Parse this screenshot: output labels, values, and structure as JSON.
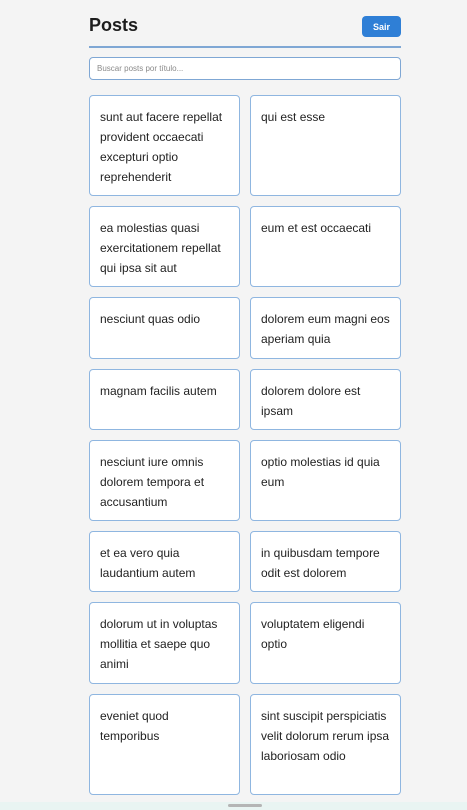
{
  "header": {
    "title": "Posts",
    "logout_label": "Sair"
  },
  "search": {
    "placeholder": "Buscar posts por título...",
    "value": ""
  },
  "posts": [
    {
      "title": "sunt aut facere repellat provident occaecati excepturi optio reprehenderit"
    },
    {
      "title": "qui est esse"
    },
    {
      "title": "ea molestias quasi exercitationem repellat qui ipsa sit aut"
    },
    {
      "title": "eum et est occaecati"
    },
    {
      "title": "nesciunt quas odio"
    },
    {
      "title": "dolorem eum magni eos aperiam quia"
    },
    {
      "title": "magnam facilis autem"
    },
    {
      "title": "dolorem dolore est ipsam"
    },
    {
      "title": "nesciunt iure omnis dolorem tempora et accusantium"
    },
    {
      "title": "optio molestias id quia eum"
    },
    {
      "title": "et ea vero quia laudantium autem"
    },
    {
      "title": "in quibusdam tempore odit est dolorem"
    },
    {
      "title": "dolorum ut in voluptas mollitia et saepe quo animi"
    },
    {
      "title": "voluptatem eligendi optio"
    },
    {
      "title": "eveniet quod temporibus"
    },
    {
      "title": "sint suscipit perspiciatis velit dolorum rerum ipsa laboriosam odio"
    }
  ],
  "colors": {
    "accent": "#2f7fd6",
    "card_border": "#8fb6e0",
    "background": "#f4f4f4"
  }
}
